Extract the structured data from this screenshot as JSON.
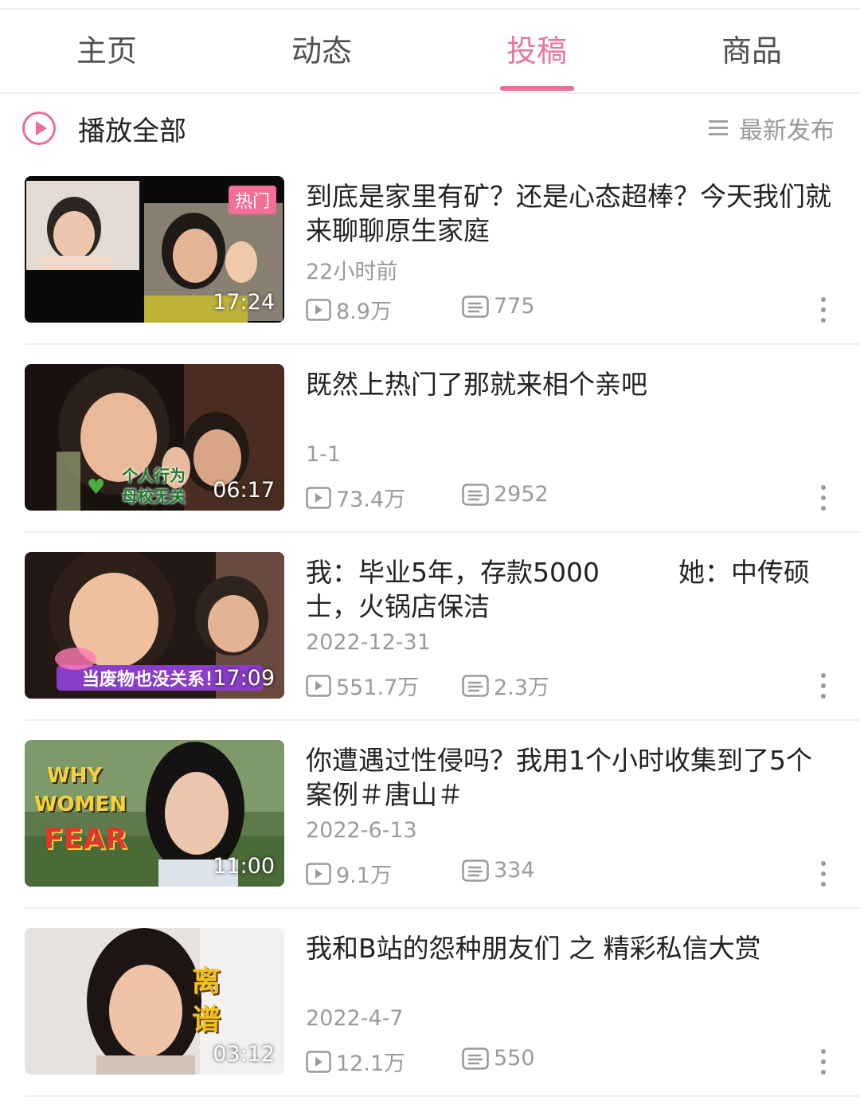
{
  "tabs": [
    "主页",
    "动态",
    "投稿",
    "商品"
  ],
  "active_tab": "投稿",
  "play_all": {
    "label": "播放全部",
    "icon": "play-circle-icon"
  },
  "sort": {
    "label": "最新发布",
    "icon": "list-sort-icon"
  },
  "colors": {
    "accent": "#ea6e96",
    "text": "#222222",
    "muted": "#9a9a9a"
  },
  "videos": [
    {
      "title": "到底是家里有矿？还是心态超棒？今天我们就来聊聊原生家庭",
      "date": "22小时前",
      "views": "8.9万",
      "comments": "775",
      "duration": "17:24",
      "badge": "热门"
    },
    {
      "title": "既然上热门了那就来相个亲吧",
      "date": "1-1",
      "views": "73.4万",
      "comments": "2952",
      "duration": "06:17",
      "thumb_text": [
        "个人行为",
        "母校无关"
      ]
    },
    {
      "title": "我：毕业5年，存款5000　　　她：中传硕士，火锅店保洁",
      "date": "2022-12-31",
      "views": "551.7万",
      "comments": "2.3万",
      "duration": "17:09",
      "thumb_text": "当废物也没关系！"
    },
    {
      "title": "你遭遇过性侵吗？我用1个小时收集到了5个案例＃唐山＃",
      "date": "2022-6-13",
      "views": "9.1万",
      "comments": "334",
      "duration": "11:00",
      "thumb_text": [
        "WHY",
        "WOMEN",
        "FEAR"
      ]
    },
    {
      "title": "我和B站的怨种朋友们 之 精彩私信大赏",
      "date": "2022-4-7",
      "views": "12.1万",
      "comments": "550",
      "duration": "03:12",
      "thumb_text": [
        "离",
        "谱"
      ]
    }
  ]
}
